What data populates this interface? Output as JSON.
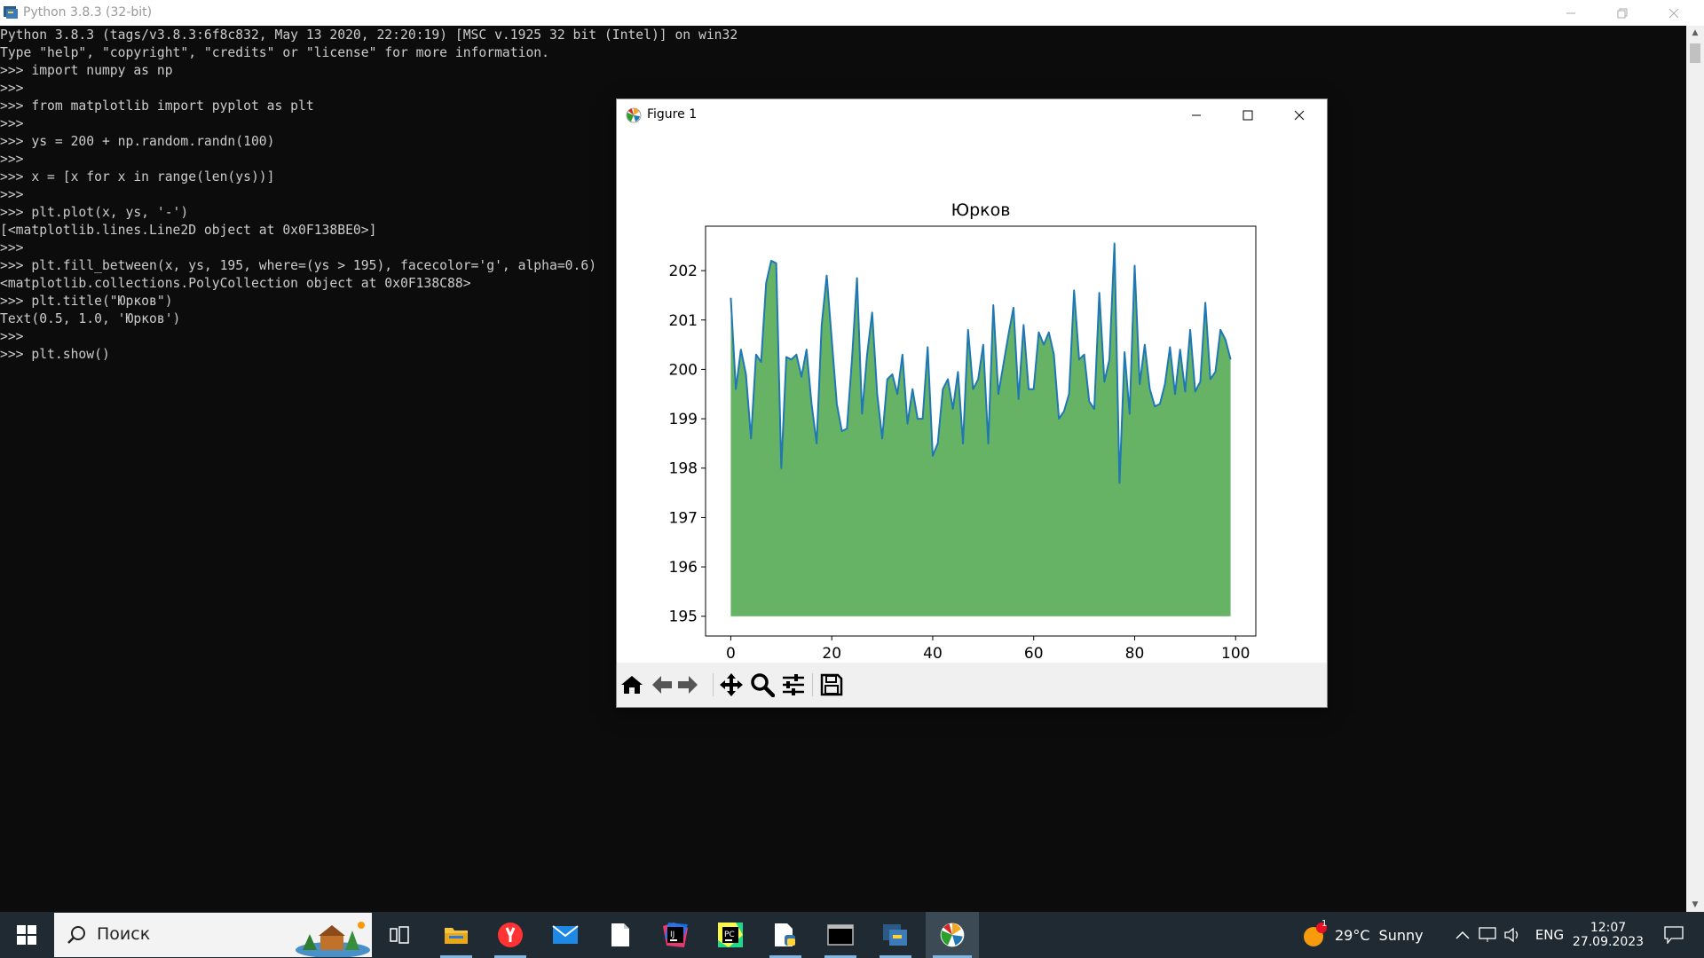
{
  "console": {
    "title": "Python 3.8.3 (32-bit)",
    "lines": [
      "Python 3.8.3 (tags/v3.8.3:6f8c832, May 13 2020, 22:20:19) [MSC v.1925 32 bit (Intel)] on win32",
      "Type \"help\", \"copyright\", \"credits\" or \"license\" for more information.",
      ">>> import numpy as np",
      ">>>",
      ">>> from matplotlib import pyplot as plt",
      ">>>",
      ">>> ys = 200 + np.random.randn(100)",
      ">>>",
      ">>> x = [x for x in range(len(ys))]",
      ">>>",
      ">>> plt.plot(x, ys, '-')",
      "[<matplotlib.lines.Line2D object at 0x0F138BE0>]",
      ">>>",
      ">>> plt.fill_between(x, ys, 195, where=(ys > 195), facecolor='g', alpha=0.6)",
      "<matplotlib.collections.PolyCollection object at 0x0F138C88>",
      ">>> plt.title(\"Юрков\")",
      "Text(0.5, 1.0, 'Юрков')",
      ">>>",
      ">>> plt.show()"
    ]
  },
  "figure": {
    "window_title": "Figure 1",
    "toolbar_icons": [
      "home-icon",
      "back-arrow-icon",
      "forward-arrow-icon",
      "pan-icon",
      "zoom-icon",
      "configure-subplots-icon",
      "save-icon"
    ]
  },
  "chart_data": {
    "type": "area",
    "title": "Юрков",
    "xlabel": "",
    "ylabel": "",
    "xlim": [
      -5,
      104
    ],
    "ylim": [
      194.6,
      202.9
    ],
    "xticks": [
      0,
      20,
      40,
      60,
      80,
      100
    ],
    "yticks": [
      195,
      196,
      197,
      198,
      199,
      200,
      201,
      202
    ],
    "fill_baseline": 195,
    "line_color": "#1f77b4",
    "fill_color": "#008000",
    "fill_alpha": 0.6,
    "grid": false,
    "x": [
      0,
      1,
      2,
      3,
      4,
      5,
      6,
      7,
      8,
      9,
      10,
      11,
      12,
      13,
      14,
      15,
      16,
      17,
      18,
      19,
      20,
      21,
      22,
      23,
      24,
      25,
      26,
      27,
      28,
      29,
      30,
      31,
      32,
      33,
      34,
      35,
      36,
      37,
      38,
      39,
      40,
      41,
      42,
      43,
      44,
      45,
      46,
      47,
      48,
      49,
      50,
      51,
      52,
      53,
      54,
      55,
      56,
      57,
      58,
      59,
      60,
      61,
      62,
      63,
      64,
      65,
      66,
      67,
      68,
      69,
      70,
      71,
      72,
      73,
      74,
      75,
      76,
      77,
      78,
      79,
      80,
      81,
      82,
      83,
      84,
      85,
      86,
      87,
      88,
      89,
      90,
      91,
      92,
      93,
      94,
      95,
      96,
      97,
      98,
      99
    ],
    "y": [
      201.45,
      199.6,
      200.4,
      199.9,
      198.6,
      200.3,
      200.15,
      201.75,
      202.2,
      202.15,
      198.0,
      200.25,
      200.2,
      200.3,
      199.85,
      200.4,
      199.3,
      198.5,
      200.9,
      201.9,
      200.6,
      199.3,
      198.75,
      198.8,
      200.2,
      201.85,
      199.1,
      200.3,
      201.15,
      199.5,
      198.6,
      199.8,
      199.9,
      199.5,
      200.3,
      198.9,
      199.6,
      199.0,
      199.0,
      200.45,
      198.25,
      198.5,
      199.6,
      199.8,
      199.2,
      199.95,
      198.5,
      200.8,
      199.6,
      199.8,
      200.5,
      198.5,
      201.3,
      199.5,
      200.1,
      200.7,
      201.25,
      199.4,
      200.9,
      199.6,
      199.6,
      200.75,
      200.5,
      200.75,
      200.3,
      199.0,
      199.15,
      199.5,
      201.6,
      200.2,
      200.3,
      199.35,
      199.2,
      201.55,
      199.75,
      200.2,
      202.55,
      197.7,
      200.35,
      199.1,
      202.1,
      199.7,
      200.5,
      199.6,
      199.25,
      199.3,
      199.7,
      200.45,
      199.5,
      200.4,
      199.55,
      200.8,
      199.55,
      199.75,
      201.35,
      199.8,
      199.95,
      200.8,
      200.6,
      200.2
    ]
  },
  "taskbar": {
    "search_placeholder": "Поиск",
    "weather_temp": "29°C",
    "weather_text": "Sunny",
    "weather_badge": "1",
    "language": "ENG",
    "time": "12:07",
    "date": "27.09.2023",
    "icons": [
      "windows-start-icon",
      "search-icon",
      "task-view-icon",
      "file-explorer-icon",
      "yandex-browser-icon",
      "mail-icon",
      "document-icon",
      "intellij-idea-icon",
      "pycharm-icon",
      "python-file-icon",
      "terminal-icon",
      "python-icon",
      "matplotlib-icon"
    ]
  }
}
